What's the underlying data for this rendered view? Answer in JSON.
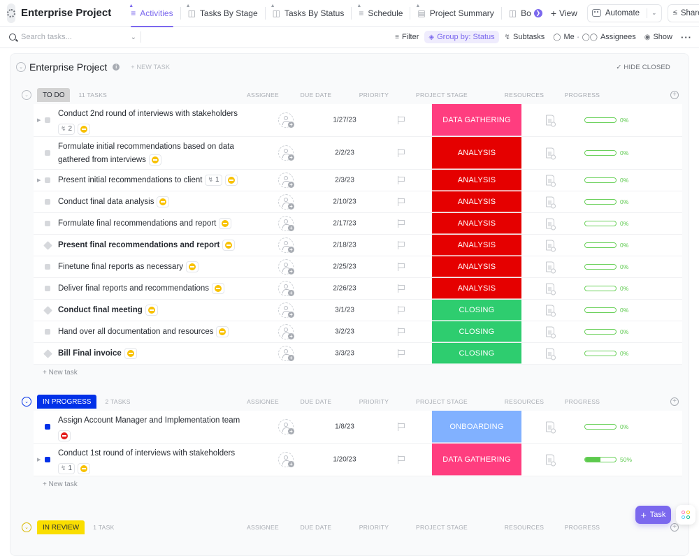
{
  "header": {
    "project_title": "Enterprise Project",
    "tabs": [
      {
        "label": "Activities",
        "icon": "list-icon",
        "active": true
      },
      {
        "label": "Tasks By Stage",
        "icon": "board-icon",
        "active": false
      },
      {
        "label": "Tasks By Status",
        "icon": "board-icon",
        "active": false
      },
      {
        "label": "Schedule",
        "icon": "gantt-icon",
        "active": false
      },
      {
        "label": "Project Summary",
        "icon": "doc-icon",
        "active": false
      },
      {
        "label": "Bo",
        "icon": "board-icon",
        "active": false
      }
    ],
    "add_view_label": "View",
    "automate_label": "Automate",
    "share_label": "Share"
  },
  "toolbar": {
    "search_placeholder": "Search tasks...",
    "filter_label": "Filter",
    "group_by_label": "Group by: Status",
    "subtasks_label": "Subtasks",
    "me_label": "Me",
    "assignees_label": "Assignees",
    "show_label": "Show"
  },
  "list": {
    "title": "Enterprise Project",
    "new_task_label": "+ NEW TASK",
    "hide_closed_label": "HIDE CLOSED",
    "columns": {
      "assignee": "ASSIGNEE",
      "due_date": "DUE DATE",
      "priority": "PRIORITY",
      "project_stage": "PROJECT STAGE",
      "resources": "RESOURCES",
      "progress": "PROGRESS"
    },
    "add_task_row_label": "+ New task",
    "stage_colors": {
      "DATA GATHERING": "#ff3d7f",
      "ANALYSIS": "#e50000",
      "CLOSING": "#2ecd6f",
      "ONBOARDING": "#81b1ff"
    },
    "groups": [
      {
        "status": "TO DO",
        "count_label": "11 TASKS",
        "pill_bg": "#d3d3d3",
        "pill_fg": "#292d34",
        "tasks": [
          {
            "name": "Conduct 2nd round of interviews with stakeholders",
            "subtasks": "2",
            "has_expand": true,
            "milestone": false,
            "bold": false,
            "priority": "normal",
            "due": "1/27/23",
            "stage": "DATA GATHERING",
            "progress": 0,
            "progress_label": "0%",
            "wrap_badges": true
          },
          {
            "name": "Formulate initial recommendations based on data gathered from interviews",
            "subtasks": null,
            "has_expand": false,
            "milestone": false,
            "bold": false,
            "priority": "normal",
            "due": "2/2/23",
            "stage": "ANALYSIS",
            "progress": 0,
            "progress_label": "0%"
          },
          {
            "name": "Present initial recommendations to client",
            "subtasks": "1",
            "has_expand": true,
            "milestone": false,
            "bold": false,
            "priority": "normal",
            "due": "2/3/23",
            "stage": "ANALYSIS",
            "progress": 0,
            "progress_label": "0%"
          },
          {
            "name": "Conduct final data analysis",
            "subtasks": null,
            "has_expand": false,
            "milestone": false,
            "bold": false,
            "priority": "normal",
            "due": "2/10/23",
            "stage": "ANALYSIS",
            "progress": 0,
            "progress_label": "0%"
          },
          {
            "name": "Formulate final recommendations and report",
            "subtasks": null,
            "has_expand": false,
            "milestone": false,
            "bold": false,
            "priority": "normal",
            "due": "2/17/23",
            "stage": "ANALYSIS",
            "progress": 0,
            "progress_label": "0%"
          },
          {
            "name": "Present final recommendations and report",
            "subtasks": null,
            "has_expand": false,
            "milestone": true,
            "bold": true,
            "priority": "normal",
            "due": "2/18/23",
            "stage": "ANALYSIS",
            "progress": 0,
            "progress_label": "0%"
          },
          {
            "name": "Finetune final reports as necessary",
            "subtasks": null,
            "has_expand": false,
            "milestone": false,
            "bold": false,
            "priority": "normal",
            "due": "2/25/23",
            "stage": "ANALYSIS",
            "progress": 0,
            "progress_label": "0%"
          },
          {
            "name": "Deliver final reports and recommendations",
            "subtasks": null,
            "has_expand": false,
            "milestone": false,
            "bold": false,
            "priority": "normal",
            "due": "2/26/23",
            "stage": "ANALYSIS",
            "progress": 0,
            "progress_label": "0%"
          },
          {
            "name": "Conduct final meeting",
            "subtasks": null,
            "has_expand": false,
            "milestone": true,
            "bold": true,
            "priority": "normal",
            "due": "3/1/23",
            "stage": "CLOSING",
            "progress": 0,
            "progress_label": "0%"
          },
          {
            "name": "Hand over all documentation and resources",
            "subtasks": null,
            "has_expand": false,
            "milestone": false,
            "bold": false,
            "priority": "normal",
            "due": "3/2/23",
            "stage": "CLOSING",
            "progress": 0,
            "progress_label": "0%"
          },
          {
            "name": "Bill Final invoice",
            "subtasks": null,
            "has_expand": false,
            "milestone": true,
            "bold": true,
            "priority": "normal",
            "due": "3/3/23",
            "stage": "CLOSING",
            "progress": 0,
            "progress_label": "0%"
          }
        ]
      },
      {
        "status": "IN PROGRESS",
        "count_label": "2 TASKS",
        "pill_bg": "#0231e8",
        "pill_fg": "#ffffff",
        "tasks": [
          {
            "name": "Assign Account Manager and Implementation team",
            "subtasks": null,
            "has_expand": false,
            "milestone": false,
            "bold": false,
            "priority": "urgent",
            "due": "1/8/23",
            "stage": "ONBOARDING",
            "progress": 0,
            "progress_label": "0%",
            "wrap_badges": true
          },
          {
            "name": "Conduct 1st round of interviews with stakeholders",
            "subtasks": "1",
            "has_expand": true,
            "milestone": false,
            "bold": false,
            "priority": "normal",
            "due": "1/20/23",
            "stage": "DATA GATHERING",
            "progress": 50,
            "progress_label": "50%",
            "wrap_badges": true
          }
        ]
      },
      {
        "status": "IN REVIEW",
        "count_label": "1 TASK",
        "pill_bg": "#fade00",
        "pill_fg": "#292d34",
        "tasks": []
      }
    ]
  },
  "fab": {
    "label": "Task"
  }
}
